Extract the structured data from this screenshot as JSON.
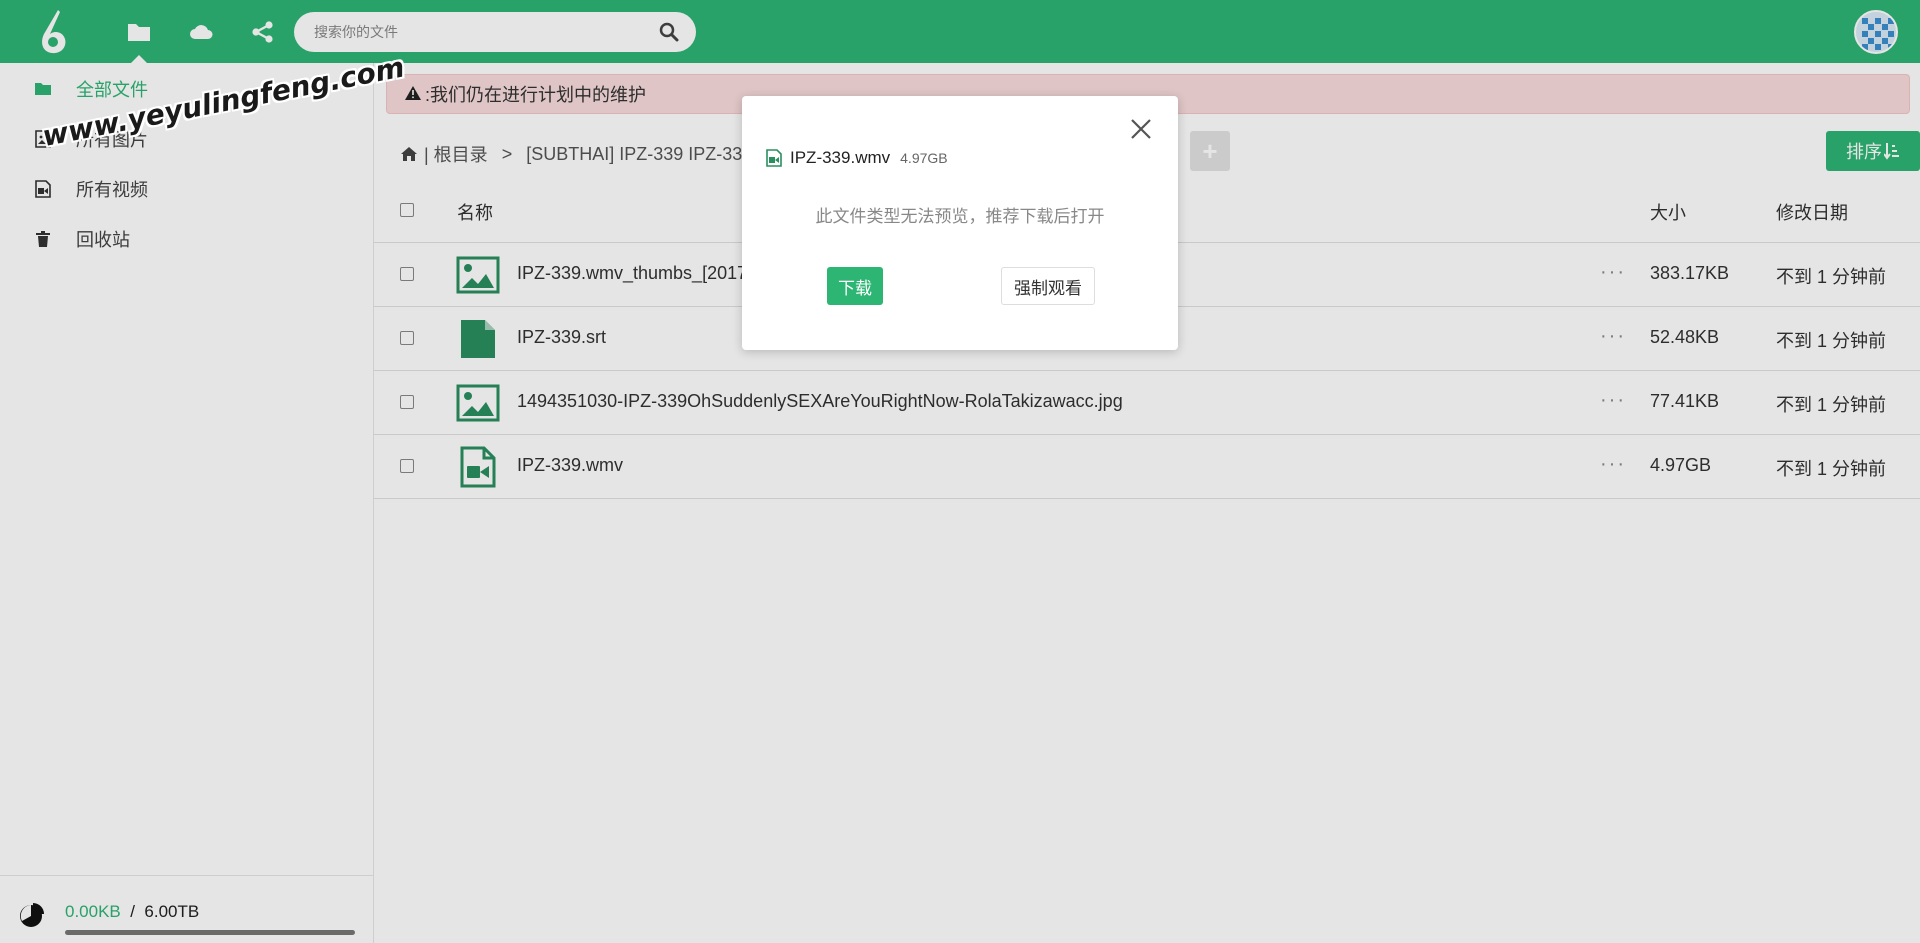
{
  "colors": {
    "brand": "#2db574",
    "alert_bg": "#f9dcdc"
  },
  "topbar": {
    "logo_icon": "six-logo-icon",
    "nav": [
      {
        "icon": "folder-icon",
        "active": true
      },
      {
        "icon": "cloud-icon",
        "active": false
      },
      {
        "icon": "share-icon",
        "active": false
      }
    ],
    "search": {
      "placeholder": "搜索你的文件",
      "icon": "search-icon"
    },
    "avatar_icon": "avatar-icon"
  },
  "sidebar": {
    "items": [
      {
        "label": "全部文件",
        "icon": "folder-icon",
        "active": true
      },
      {
        "label": "所有图片",
        "icon": "image-file-icon",
        "active": false
      },
      {
        "label": "所有视频",
        "icon": "video-file-icon",
        "active": false
      },
      {
        "label": "回收站",
        "icon": "trash-icon",
        "active": false
      }
    ],
    "storage": {
      "used": "0.00KB",
      "separator": "/",
      "total": "6.00TB",
      "used_fraction": 0
    }
  },
  "main": {
    "alert": {
      "text": ":我们仍在进行计划中的维护",
      "icon": "warning-icon"
    },
    "breadcrumb": {
      "home_icon": "home-icon",
      "root": "| 根目录",
      "separator": ">",
      "current": "[SUBTHAI] IPZ-339 IPZ-339 ("
    },
    "add_label": "+",
    "sort_label": "排序",
    "columns": {
      "name": "名称",
      "size": "大小",
      "date": "修改日期"
    },
    "files": [
      {
        "name": "IPZ-339.wmv_thumbs_[2017",
        "size": "383.17KB",
        "date": "不到 1 分钟前",
        "type": "image"
      },
      {
        "name": "IPZ-339.srt",
        "size": "52.48KB",
        "date": "不到 1 分钟前",
        "type": "file"
      },
      {
        "name": "1494351030-IPZ-339OhSuddenlySEXAreYouRightNow-RolaTakizawacc.jpg",
        "size": "77.41KB",
        "date": "不到 1 分钟前",
        "type": "image"
      },
      {
        "name": "IPZ-339.wmv",
        "size": "4.97GB",
        "date": "不到 1 分钟前",
        "type": "video"
      }
    ],
    "more_label": "···"
  },
  "modal": {
    "file_name": "IPZ-339.wmv",
    "file_size": "4.97GB",
    "message": "此文件类型无法预览，推荐下载后打开",
    "download_label": "下载",
    "force_label": "强制观看"
  },
  "watermark": "www.yeyulingfeng.com"
}
